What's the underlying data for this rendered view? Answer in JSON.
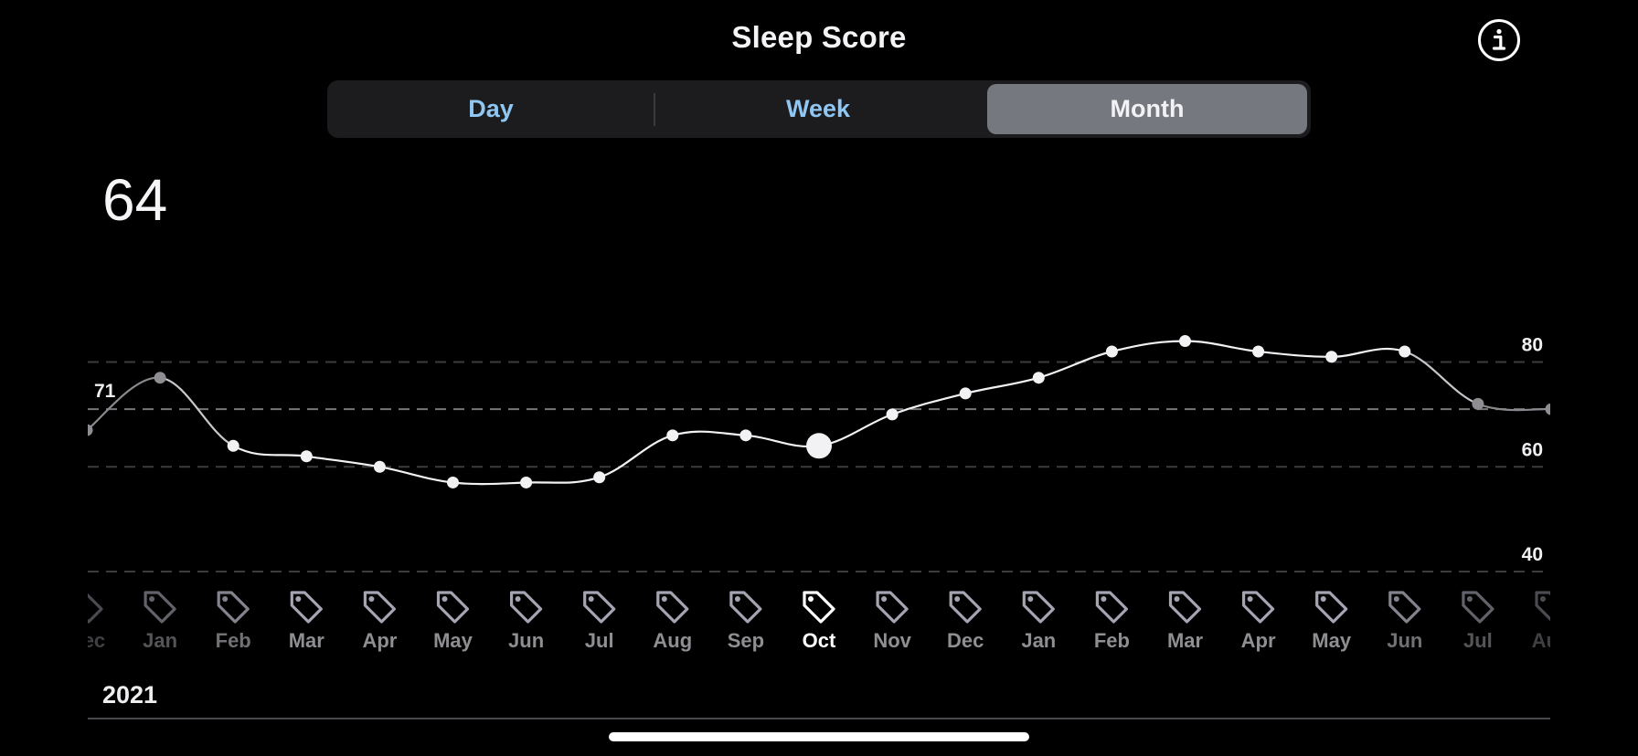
{
  "header": {
    "title": "Sleep Score",
    "info_icon": "info-circle-icon"
  },
  "segments": [
    {
      "label": "Day",
      "selected": false
    },
    {
      "label": "Week",
      "selected": false
    },
    {
      "label": "Month",
      "selected": true
    }
  ],
  "summary": {
    "selected_value": "64"
  },
  "footer": {
    "year_label": "2021"
  },
  "colors": {
    "background": "#000000",
    "segment_accent": "#8fc6f2",
    "segment_selected_bg": "#76787f",
    "line": "#f2f2f4",
    "faded_line": "#8a8a8e",
    "gridline": "#3c3c40",
    "reference_line": "#77777b",
    "month_label": "#8e8e93",
    "tag_icon": "#a4a4b2"
  },
  "chart_data": {
    "type": "line",
    "title": "Sleep Score",
    "xlabel": "",
    "ylabel": "",
    "ylim": [
      40,
      80
    ],
    "yticks": [
      40,
      60,
      80
    ],
    "grid": true,
    "reference_line": {
      "value": 71,
      "label": "71"
    },
    "selected_index": 10,
    "selected_value": 64,
    "categories": [
      "Dec",
      "Jan",
      "Feb",
      "Mar",
      "Apr",
      "May",
      "Jun",
      "Jul",
      "Aug",
      "Sep",
      "Oct",
      "Nov",
      "Dec",
      "Jan",
      "Feb",
      "Mar",
      "Apr",
      "May",
      "Jun",
      "Jul",
      "Aug"
    ],
    "series": [
      {
        "name": "Sleep Score",
        "values": [
          67,
          77,
          64,
          62,
          60,
          57,
          57,
          58,
          66,
          66,
          64,
          70,
          74,
          77,
          82,
          84,
          82,
          81,
          82,
          72,
          71
        ]
      }
    ],
    "faded_indices": [
      0,
      1,
      19,
      20
    ],
    "category_icon": "tag-icon"
  }
}
